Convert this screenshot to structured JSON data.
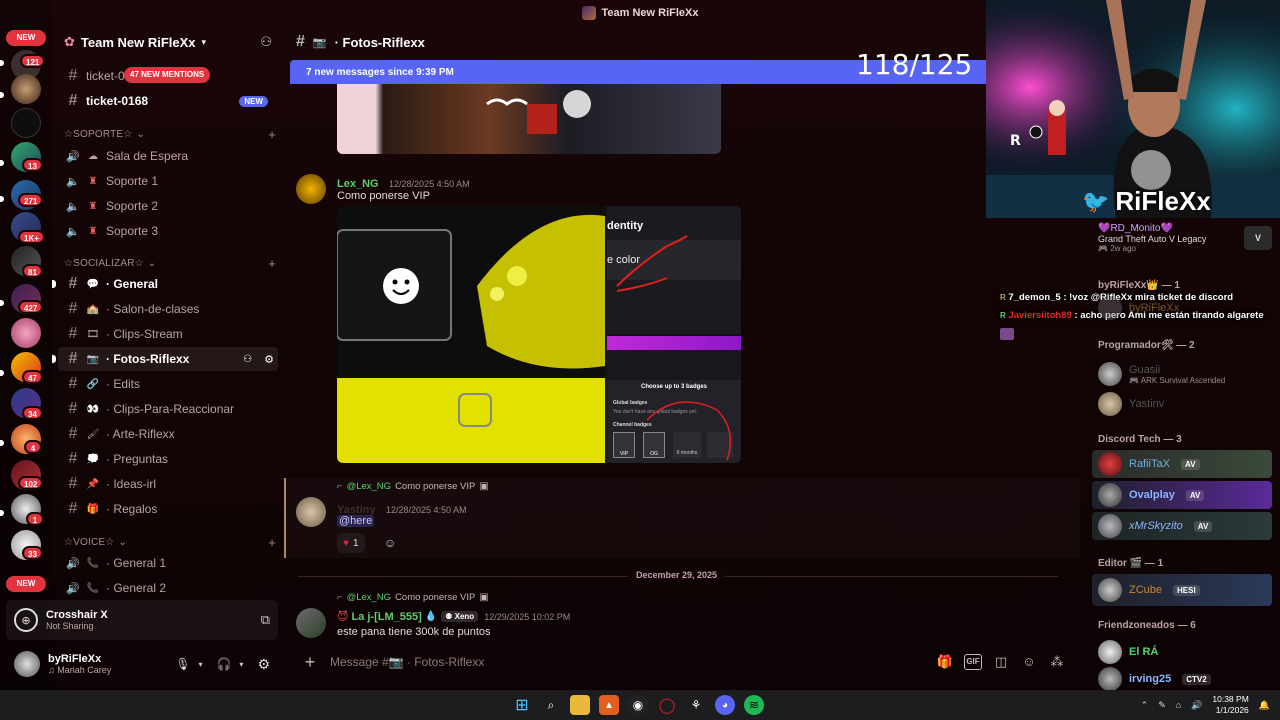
{
  "window": {
    "title": "Team New RiFleXx"
  },
  "rail": {
    "new_top": "NEW",
    "new_bottom": "NEW",
    "badges": [
      "121",
      "13",
      "271",
      "1K+",
      "81",
      "427",
      "47",
      "34",
      "4",
      "102",
      "1",
      "33"
    ]
  },
  "server": {
    "name": "Team New RiFleXx"
  },
  "channels": {
    "top": [
      {
        "name": "ticket-0",
        "mentions": "47 NEW MENTIONS"
      },
      {
        "name": "ticket-0168",
        "badge": "NEW"
      }
    ],
    "soporte": {
      "label": "☆SOPORTE☆",
      "items": [
        "Sala de Espera",
        "Soporte 1",
        "Soporte 2",
        "Soporte 3"
      ]
    },
    "socializar": {
      "label": "☆SOCIALIZAR☆",
      "items": [
        "· General",
        "· Salon-de-clases",
        "· Clips-Stream",
        "· Fotos-Riflexx",
        "· Edits",
        "· Clips-Para-Reaccionar",
        "· Arte-Riflexx",
        "· Preguntas",
        "· Ideas-irl",
        "· Regalos"
      ]
    },
    "voice": {
      "label": "☆VOICE☆",
      "items": [
        "· General 1",
        "· General 2"
      ]
    }
  },
  "voice_panel": {
    "title": "Crosshair X",
    "status": "Not Sharing"
  },
  "user_panel": {
    "name": "byRiFleXx",
    "activity": "Mariah Carey"
  },
  "chat": {
    "channel": "· Fotos-Riflexx",
    "new_messages_bar": "7 new messages since 9:39 PM",
    "stream_counter": "118/125",
    "msg1": {
      "author": "Lex_NG",
      "time": "12/28/2025 4:50 AM",
      "text": "Como ponerse VIP"
    },
    "image_texts": {
      "identity": "dentity",
      "color": "e color",
      "modal_title": "Choose up to 3 badges",
      "global": "Global badges",
      "global_note": "You don't have any global badges yet.",
      "channel": "Channel badges",
      "months": "6 months",
      "vip": "VIP",
      "og": "OG"
    },
    "msg2": {
      "reply_author": "@Lex_NG",
      "reply_text": "Como ponerse VIP",
      "author": "Yastiny",
      "time": "12/28/2025 4:50 AM",
      "text": "@here",
      "reaction_count": "1"
    },
    "date_divider": "December 29, 2025",
    "msg3": {
      "reply_author": "@Lex_NG",
      "reply_text": "Como ponerse VIP",
      "author": "La j-[LM_555]",
      "tag": "Xeno",
      "time": "12/29/2025 10:02 PM",
      "text": "este pana tiene 300k de puntos"
    },
    "composer_placeholder": "Message #📷 · Fotos-Riflexx"
  },
  "webcam": {
    "name": "RiFleXx"
  },
  "stream_chat": [
    {
      "user": "7_demon_5",
      "text": ": !voz @RifleXx mira ticket de discord",
      "color": "#ffffff"
    },
    {
      "user": "Javiersiitoh89",
      "text": ": acho pero Ami me están tirando algarete",
      "color": "#e02a2a"
    }
  ],
  "members": {
    "top_user": {
      "name": "💜RD_Monito💜",
      "activity": "Grand Theft Auto V Legacy",
      "time": "2w ago"
    },
    "groups": [
      {
        "label": "byRiFleXx👑 — 1",
        "items": [
          {
            "name": "byRiFleXx",
            "sub": ""
          }
        ]
      },
      {
        "label": "Programador🛠 — 2",
        "items": [
          {
            "name": "Guasii",
            "sub": "ARK Survival Ascended"
          },
          {
            "name": "Yastinv",
            "sub": ""
          }
        ]
      },
      {
        "label": "Discord Tech — 3",
        "items": [
          {
            "name": "RafiiTaX",
            "tag": "AV"
          },
          {
            "name": "Ovalplay",
            "tag": "AV"
          },
          {
            "name": "xMrSkyzito",
            "tag": "AV"
          }
        ]
      },
      {
        "label": "Editor 🎬 — 1",
        "items": [
          {
            "name": "ZCube",
            "tag": "HESI"
          }
        ]
      },
      {
        "label": "Friendzoneados — 6",
        "items": [
          {
            "name": "El RÁ"
          },
          {
            "name": "irving25",
            "tag": "CTV2"
          }
        ]
      }
    ]
  },
  "taskbar": {
    "time": "10:38 PM",
    "date": "1/1/2026"
  },
  "colors": {
    "accent": "#5865f2",
    "danger": "#e0353f",
    "mention": "#e0353f"
  }
}
